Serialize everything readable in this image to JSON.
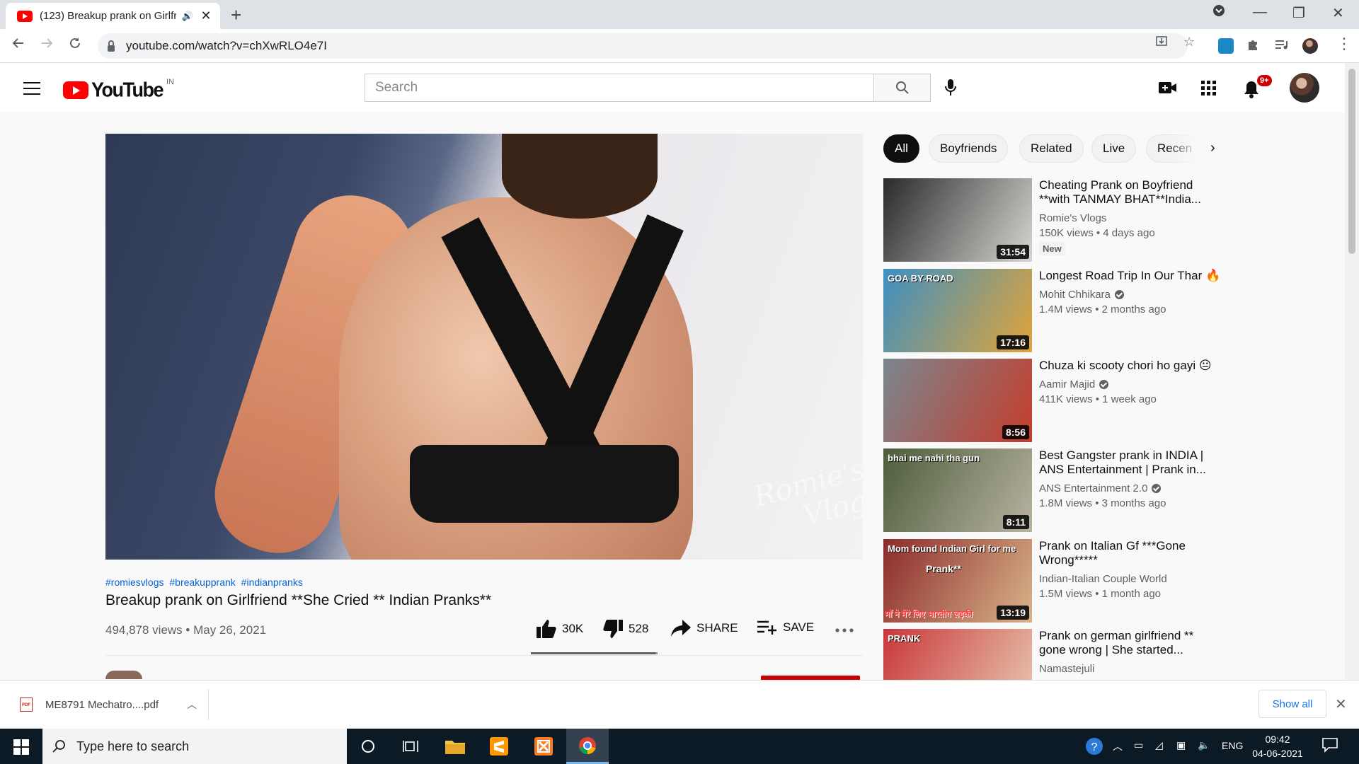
{
  "browser": {
    "tab_title": "(123) Breakup prank on Girlfr",
    "tab_audio_icon": "speaker-icon",
    "url": "youtube.com/watch?v=chXwRLO4e7I"
  },
  "masthead": {
    "logo_text": "YouTube",
    "country_code": "IN",
    "search_placeholder": "Search",
    "notification_count": "9+"
  },
  "video": {
    "hashtags": [
      "#romiesvlogs",
      "#breakupprank",
      "#indianpranks"
    ],
    "title": "Breakup prank on Girlfriend **She Cried ** Indian Pranks**",
    "views_date": "494,878 views • May 26, 2021",
    "likes": "30K",
    "dislikes": "528",
    "like_ratio": 0.983,
    "share_label": "SHARE",
    "save_label": "SAVE",
    "watermark_line1": "Romie's",
    "watermark_line2": "Vlogs"
  },
  "chips": [
    "All",
    "Boyfriends",
    "Related",
    "Live",
    "Recen"
  ],
  "recommendations": [
    {
      "title": "Cheating Prank on Boyfriend **with TANMAY BHAT**India...",
      "channel": "Romie's Vlogs",
      "verified": false,
      "meta": "150K views • 4 days ago",
      "badge": "New",
      "duration": "31:54",
      "thumb_colors": [
        "#2a2a2a",
        "#d8d6d2"
      ]
    },
    {
      "title": "Longest Road Trip In Our Thar 🔥",
      "channel": "Mohit Chhikara",
      "verified": true,
      "meta": "1.4M views • 2 months ago",
      "badge": "",
      "duration": "17:16",
      "thumb_text": "GOA BY-ROAD",
      "thumb_colors": [
        "#3d8fc2",
        "#e0a43a"
      ]
    },
    {
      "title": "Chuza ki scooty chori ho gayi 😐",
      "channel": "Aamir Majid",
      "verified": true,
      "meta": "411K views • 1 week ago",
      "badge": "",
      "duration": "8:56",
      "thumb_colors": [
        "#7a8790",
        "#c63c2a"
      ]
    },
    {
      "title": "Best Gangster prank in INDIA | ANS Entertainment | Prank in...",
      "channel": "ANS Entertainment 2.0",
      "verified": true,
      "meta": "1.8M views • 3 months ago",
      "badge": "",
      "duration": "8:11",
      "thumb_text": "bhai me nahi tha   gun",
      "thumb_colors": [
        "#4c5d3a",
        "#b9b3a2"
      ]
    },
    {
      "title": "Prank on Italian Gf ***Gone Wrong*****",
      "channel": "Indian-Italian Couple World",
      "verified": false,
      "meta": "1.5M views • 1 month ago",
      "badge": "",
      "duration": "13:19",
      "thumb_text": "Mom found Indian Girl for me",
      "thumb_text2": "Prank**",
      "thumb_text3": "माँ ने मेरे लिए भारतीय लड़की",
      "thumb_colors": [
        "#8b2b2b",
        "#d9b48a"
      ]
    },
    {
      "title": "Prank on german girlfriend ** gone wrong | She started...",
      "channel": "Namastejuli",
      "verified": false,
      "meta": "",
      "badge": "",
      "duration": "",
      "thumb_text": "PRANK",
      "thumb_colors": [
        "#c9373a",
        "#e8c9b0"
      ]
    }
  ],
  "downloads": {
    "file_name": "ME8791 Mechatro....pdf",
    "file_type": "PDF",
    "show_all": "Show all"
  },
  "taskbar": {
    "search_placeholder": "Type here to search",
    "language": "ENG",
    "time": "09:42",
    "date": "04-06-2021"
  }
}
